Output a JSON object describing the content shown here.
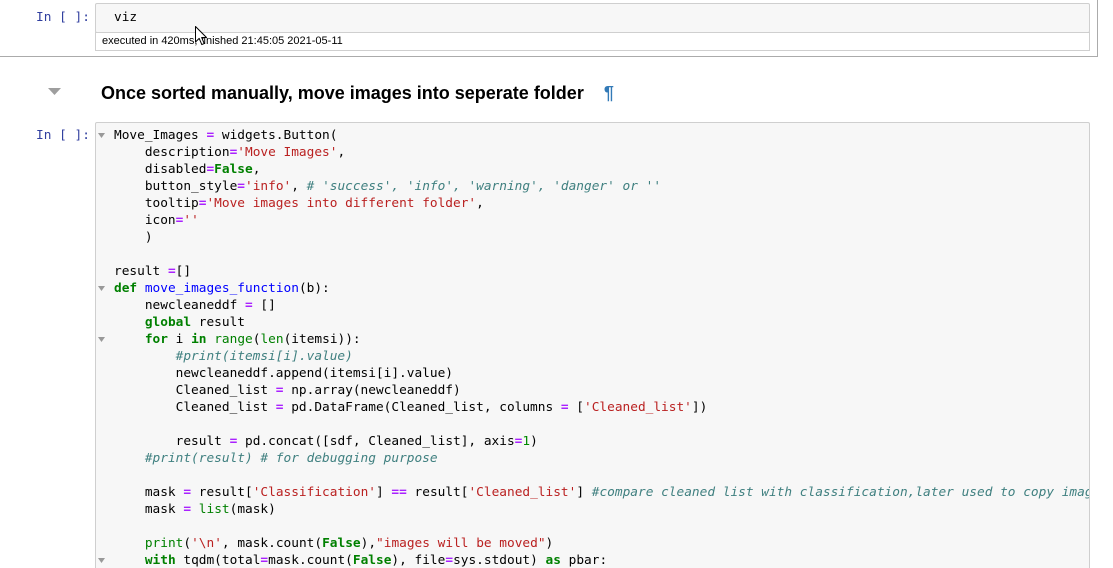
{
  "colors": {
    "prompt": "#303F9F",
    "anchor_link": "#337AB7",
    "input_background": "#F7F7F7",
    "input_border": "#CFCFCF",
    "selected_cell_border": "#ABABAB",
    "fold_marker": "#999999",
    "collapse_icon": "#9E9E9E"
  },
  "icons": {
    "heading_collapse": "caret-down-icon",
    "fold_marker": "fold-arrow-icon",
    "pointer": "mouse-cursor-icon"
  },
  "notebook": {
    "code_cell_viz": {
      "prompt": "In [ ]:",
      "lines": [
        {
          "tokens": [
            {
              "text": "viz"
            }
          ]
        }
      ],
      "execution_time": "executed in 420ms, finished 21:45:05 2021-05-11"
    },
    "heading_cell": {
      "text": "Once sorted manually, move images into seperate folder",
      "anchor_link": "¶"
    },
    "code_cell_move_images": {
      "prompt": "In [ ]:",
      "lines": [
        {
          "fold": true,
          "tokens": [
            {
              "text": "Move_Images "
            },
            {
              "text": "=",
              "color": "#AA22FF",
              "bold": true
            },
            {
              "text": " widgets.Button("
            }
          ]
        },
        {
          "tokens": [
            {
              "text": "    description"
            },
            {
              "text": "=",
              "color": "#AA22FF",
              "bold": true
            },
            {
              "text": "'Move Images'",
              "color": "#BA2121"
            },
            {
              "text": ","
            }
          ]
        },
        {
          "tokens": [
            {
              "text": "    disabled"
            },
            {
              "text": "=",
              "color": "#AA22FF",
              "bold": true
            },
            {
              "text": "False",
              "color": "#008000",
              "bold": true
            },
            {
              "text": ","
            }
          ]
        },
        {
          "tokens": [
            {
              "text": "    button_style"
            },
            {
              "text": "=",
              "color": "#AA22FF",
              "bold": true
            },
            {
              "text": "'info'",
              "color": "#BA2121"
            },
            {
              "text": ", "
            },
            {
              "text": "# 'success', 'info', 'warning', 'danger' or ''",
              "color": "#408080",
              "italic": true
            }
          ]
        },
        {
          "tokens": [
            {
              "text": "    tooltip"
            },
            {
              "text": "=",
              "color": "#AA22FF",
              "bold": true
            },
            {
              "text": "'Move images into different folder'",
              "color": "#BA2121"
            },
            {
              "text": ","
            }
          ]
        },
        {
          "tokens": [
            {
              "text": "    icon"
            },
            {
              "text": "=",
              "color": "#AA22FF",
              "bold": true
            },
            {
              "text": "''",
              "color": "#BA2121"
            }
          ]
        },
        {
          "tokens": [
            {
              "text": "    )"
            }
          ]
        },
        {
          "tokens": []
        },
        {
          "tokens": [
            {
              "text": "result "
            },
            {
              "text": "=",
              "color": "#AA22FF",
              "bold": true
            },
            {
              "text": "[]"
            }
          ]
        },
        {
          "fold": true,
          "tokens": [
            {
              "text": "def",
              "color": "#008000",
              "bold": true
            },
            {
              "text": " "
            },
            {
              "text": "move_images_function",
              "color": "#0000FF"
            },
            {
              "text": "(b):"
            }
          ]
        },
        {
          "tokens": [
            {
              "text": "    newcleaneddf "
            },
            {
              "text": "=",
              "color": "#AA22FF",
              "bold": true
            },
            {
              "text": " []"
            }
          ]
        },
        {
          "tokens": [
            {
              "text": "    "
            },
            {
              "text": "global",
              "color": "#008000",
              "bold": true
            },
            {
              "text": " result"
            }
          ]
        },
        {
          "fold": true,
          "tokens": [
            {
              "text": "    "
            },
            {
              "text": "for",
              "color": "#008000",
              "bold": true
            },
            {
              "text": " i "
            },
            {
              "text": "in",
              "color": "#008000",
              "bold": true
            },
            {
              "text": " "
            },
            {
              "text": "range",
              "color": "#008000"
            },
            {
              "text": "("
            },
            {
              "text": "len",
              "color": "#008000"
            },
            {
              "text": "(itemsi)):"
            }
          ]
        },
        {
          "tokens": [
            {
              "text": "        "
            },
            {
              "text": "#print(itemsi[i].value)",
              "color": "#408080",
              "italic": true
            }
          ]
        },
        {
          "tokens": [
            {
              "text": "        newcleaneddf.append(itemsi[i].value)"
            }
          ]
        },
        {
          "tokens": [
            {
              "text": "        Cleaned_list "
            },
            {
              "text": "=",
              "color": "#AA22FF",
              "bold": true
            },
            {
              "text": " np.array(newcleaneddf)"
            }
          ]
        },
        {
          "tokens": [
            {
              "text": "        Cleaned_list "
            },
            {
              "text": "=",
              "color": "#AA22FF",
              "bold": true
            },
            {
              "text": " pd.DataFrame(Cleaned_list, columns "
            },
            {
              "text": "=",
              "color": "#AA22FF",
              "bold": true
            },
            {
              "text": " ["
            },
            {
              "text": "'Cleaned_list'",
              "color": "#BA2121"
            },
            {
              "text": "])"
            }
          ]
        },
        {
          "tokens": []
        },
        {
          "tokens": [
            {
              "text": "        result "
            },
            {
              "text": "=",
              "color": "#AA22FF",
              "bold": true
            },
            {
              "text": " pd.concat([sdf, Cleaned_list], axis"
            },
            {
              "text": "=",
              "color": "#AA22FF",
              "bold": true
            },
            {
              "text": "1",
              "color": "#008800"
            },
            {
              "text": ")"
            }
          ]
        },
        {
          "tokens": [
            {
              "text": "    "
            },
            {
              "text": "#print(result) # for debugging purpose",
              "color": "#408080",
              "italic": true
            }
          ]
        },
        {
          "tokens": []
        },
        {
          "tokens": [
            {
              "text": "    mask "
            },
            {
              "text": "=",
              "color": "#AA22FF",
              "bold": true
            },
            {
              "text": " result["
            },
            {
              "text": "'Classification'",
              "color": "#BA2121"
            },
            {
              "text": "] "
            },
            {
              "text": "==",
              "color": "#AA22FF",
              "bold": true
            },
            {
              "text": " result["
            },
            {
              "text": "'Cleaned_list'",
              "color": "#BA2121"
            },
            {
              "text": "] "
            },
            {
              "text": "#compare cleaned list with classification,later used to copy imag",
              "color": "#408080",
              "italic": true
            }
          ]
        },
        {
          "tokens": [
            {
              "text": "    mask "
            },
            {
              "text": "=",
              "color": "#AA22FF",
              "bold": true
            },
            {
              "text": " "
            },
            {
              "text": "list",
              "color": "#008000"
            },
            {
              "text": "(mask)"
            }
          ]
        },
        {
          "tokens": []
        },
        {
          "tokens": [
            {
              "text": "    "
            },
            {
              "text": "print",
              "color": "#008000"
            },
            {
              "text": "("
            },
            {
              "text": "'\\n'",
              "color": "#BA2121"
            },
            {
              "text": ", mask.count("
            },
            {
              "text": "False",
              "color": "#008000",
              "bold": true
            },
            {
              "text": "),"
            },
            {
              "text": "\"images will be moved\"",
              "color": "#BA2121"
            },
            {
              "text": ")"
            }
          ]
        },
        {
          "fold": true,
          "tokens": [
            {
              "text": "    "
            },
            {
              "text": "with",
              "color": "#008000",
              "bold": true
            },
            {
              "text": " tqdm(total"
            },
            {
              "text": "=",
              "color": "#AA22FF",
              "bold": true
            },
            {
              "text": "mask.count("
            },
            {
              "text": "False",
              "color": "#008000",
              "bold": true
            },
            {
              "text": "), file"
            },
            {
              "text": "=",
              "color": "#AA22FF",
              "bold": true
            },
            {
              "text": "sys.stdout) "
            },
            {
              "text": "as",
              "color": "#008000",
              "bold": true
            },
            {
              "text": " pbar:"
            }
          ]
        }
      ]
    }
  }
}
